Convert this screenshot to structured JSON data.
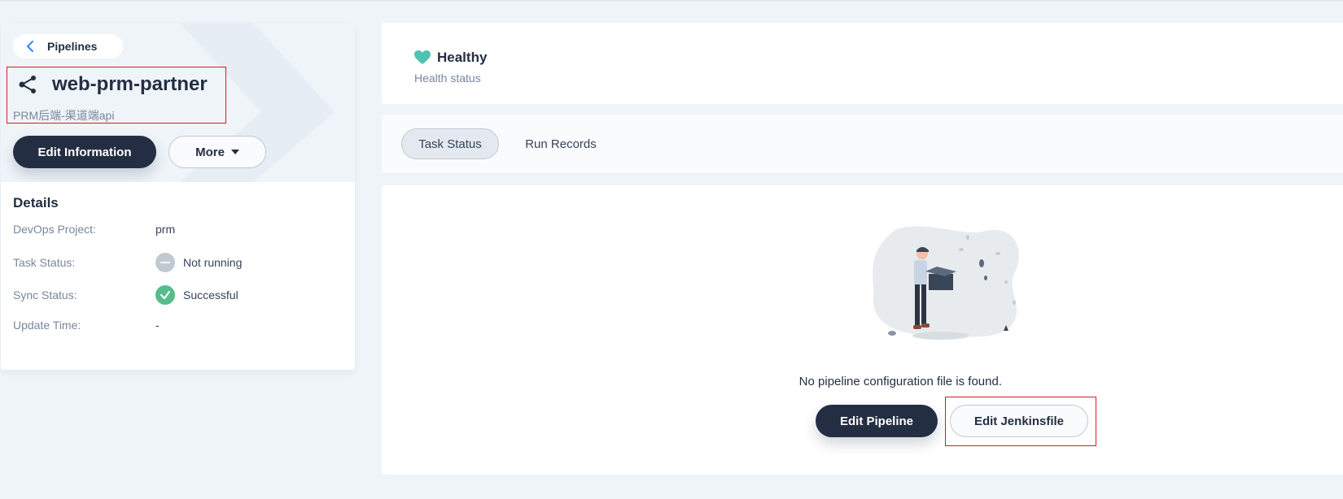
{
  "header": {
    "back_label": "Pipelines",
    "title": "web-prm-partner",
    "subtitle": "PRM后端-渠道端api",
    "edit_information_label": "Edit Information",
    "more_label": "More"
  },
  "details": {
    "title": "Details",
    "rows": [
      {
        "key": "DevOps Project:",
        "value": "prm"
      },
      {
        "key": "Task Status:",
        "value": "Not running"
      },
      {
        "key": "Sync Status:",
        "value": "Successful"
      },
      {
        "key": "Update Time:",
        "value": "-"
      }
    ]
  },
  "health": {
    "value": "Healthy",
    "label": "Health status",
    "color": "#4ec3b0"
  },
  "tabs": [
    {
      "label": "Task Status",
      "active": true
    },
    {
      "label": "Run Records",
      "active": false
    }
  ],
  "empty_state": {
    "message": "No pipeline configuration file is found.",
    "edit_pipeline_label": "Edit Pipeline",
    "edit_jenkinsfile_label": "Edit Jenkinsfile"
  },
  "colors": {
    "primary_dark": "#242e42",
    "success": "#55bc8a",
    "highlight": "#d9192a",
    "background": "#eff4f9"
  }
}
